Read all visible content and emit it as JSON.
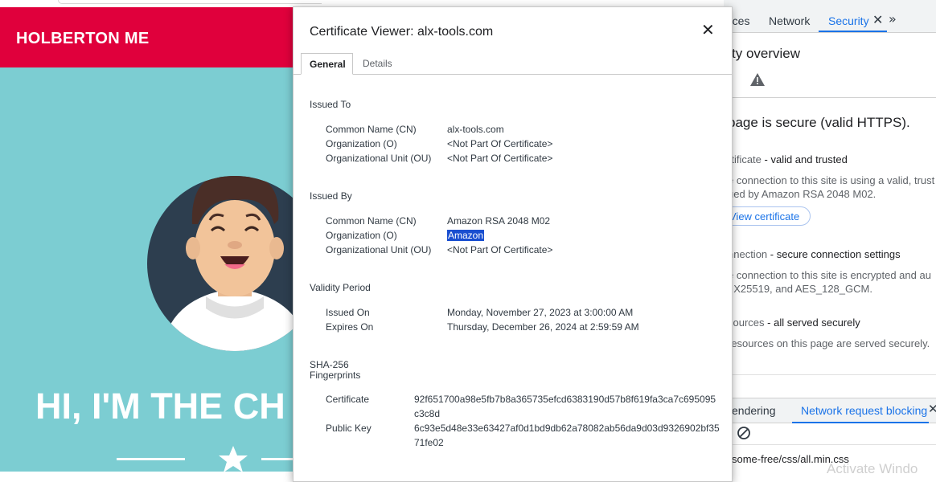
{
  "site": {
    "logo": "HOLBERTON ME",
    "hero_title": "HI, I'M THE CH"
  },
  "devtools": {
    "tabs": [
      "rces",
      "Network",
      "Security"
    ],
    "active_tab": "Security",
    "overview_title": "ty overview",
    "main_status": "page is secure (valid HTTPS).",
    "certificate": {
      "heading_prefix": "rtificate",
      "heading_suffix": " - valid and trusted",
      "line1": "e connection to this site is using a valid, trust",
      "line2": "ued by Amazon RSA 2048 M02.",
      "button": "View certificate"
    },
    "connection": {
      "heading_prefix": "nnection",
      "heading_suffix": " - secure connection settings",
      "line1": "e connection to this site is encrypted and au",
      "line2": ", X25519, and AES_128_GCM."
    },
    "resources": {
      "heading_prefix": "sources",
      "heading_suffix": " - all served securely",
      "line1": "resources on this page are served securely."
    },
    "drawer_tabs": [
      "endering",
      "Network request blocking"
    ],
    "drawer_active": "Network request blocking",
    "drawer_url": "some-free/css/all.min.css",
    "watermark": "Activate Windo"
  },
  "dialog": {
    "title": "Certificate Viewer: alx-tools.com",
    "tabs": [
      "General",
      "Details"
    ],
    "issued_to": {
      "heading": "Issued To",
      "rows": [
        {
          "label": "Common Name (CN)",
          "value": "alx-tools.com"
        },
        {
          "label": "Organization (O)",
          "value": "<Not Part Of Certificate>"
        },
        {
          "label": "Organizational Unit (OU)",
          "value": "<Not Part Of Certificate>"
        }
      ]
    },
    "issued_by": {
      "heading": "Issued By",
      "rows": [
        {
          "label": "Common Name (CN)",
          "value": "Amazon RSA 2048 M02"
        },
        {
          "label": "Organization (O)",
          "value": "Amazon"
        },
        {
          "label": "Organizational Unit (OU)",
          "value": "<Not Part Of Certificate>"
        }
      ]
    },
    "validity": {
      "heading": "Validity Period",
      "rows": [
        {
          "label": "Issued On",
          "value": "Monday, November 27, 2023 at 3:00:00 AM"
        },
        {
          "label": "Expires On",
          "value": "Thursday, December 26, 2024 at 2:59:59 AM"
        }
      ]
    },
    "fingerprints": {
      "heading_line1": "SHA-256",
      "heading_line2": "Fingerprints",
      "rows": [
        {
          "label": "Certificate",
          "value": "92f651700a98e5fb7b8a365735efcd6383190d57b8f619fa3ca7c695095c3c8d"
        },
        {
          "label": "Public Key",
          "value": "6c93e5d48e33e63427af0d1bd9db62a78082ab56da9d03d9326902bf3571fe02"
        }
      ]
    }
  }
}
